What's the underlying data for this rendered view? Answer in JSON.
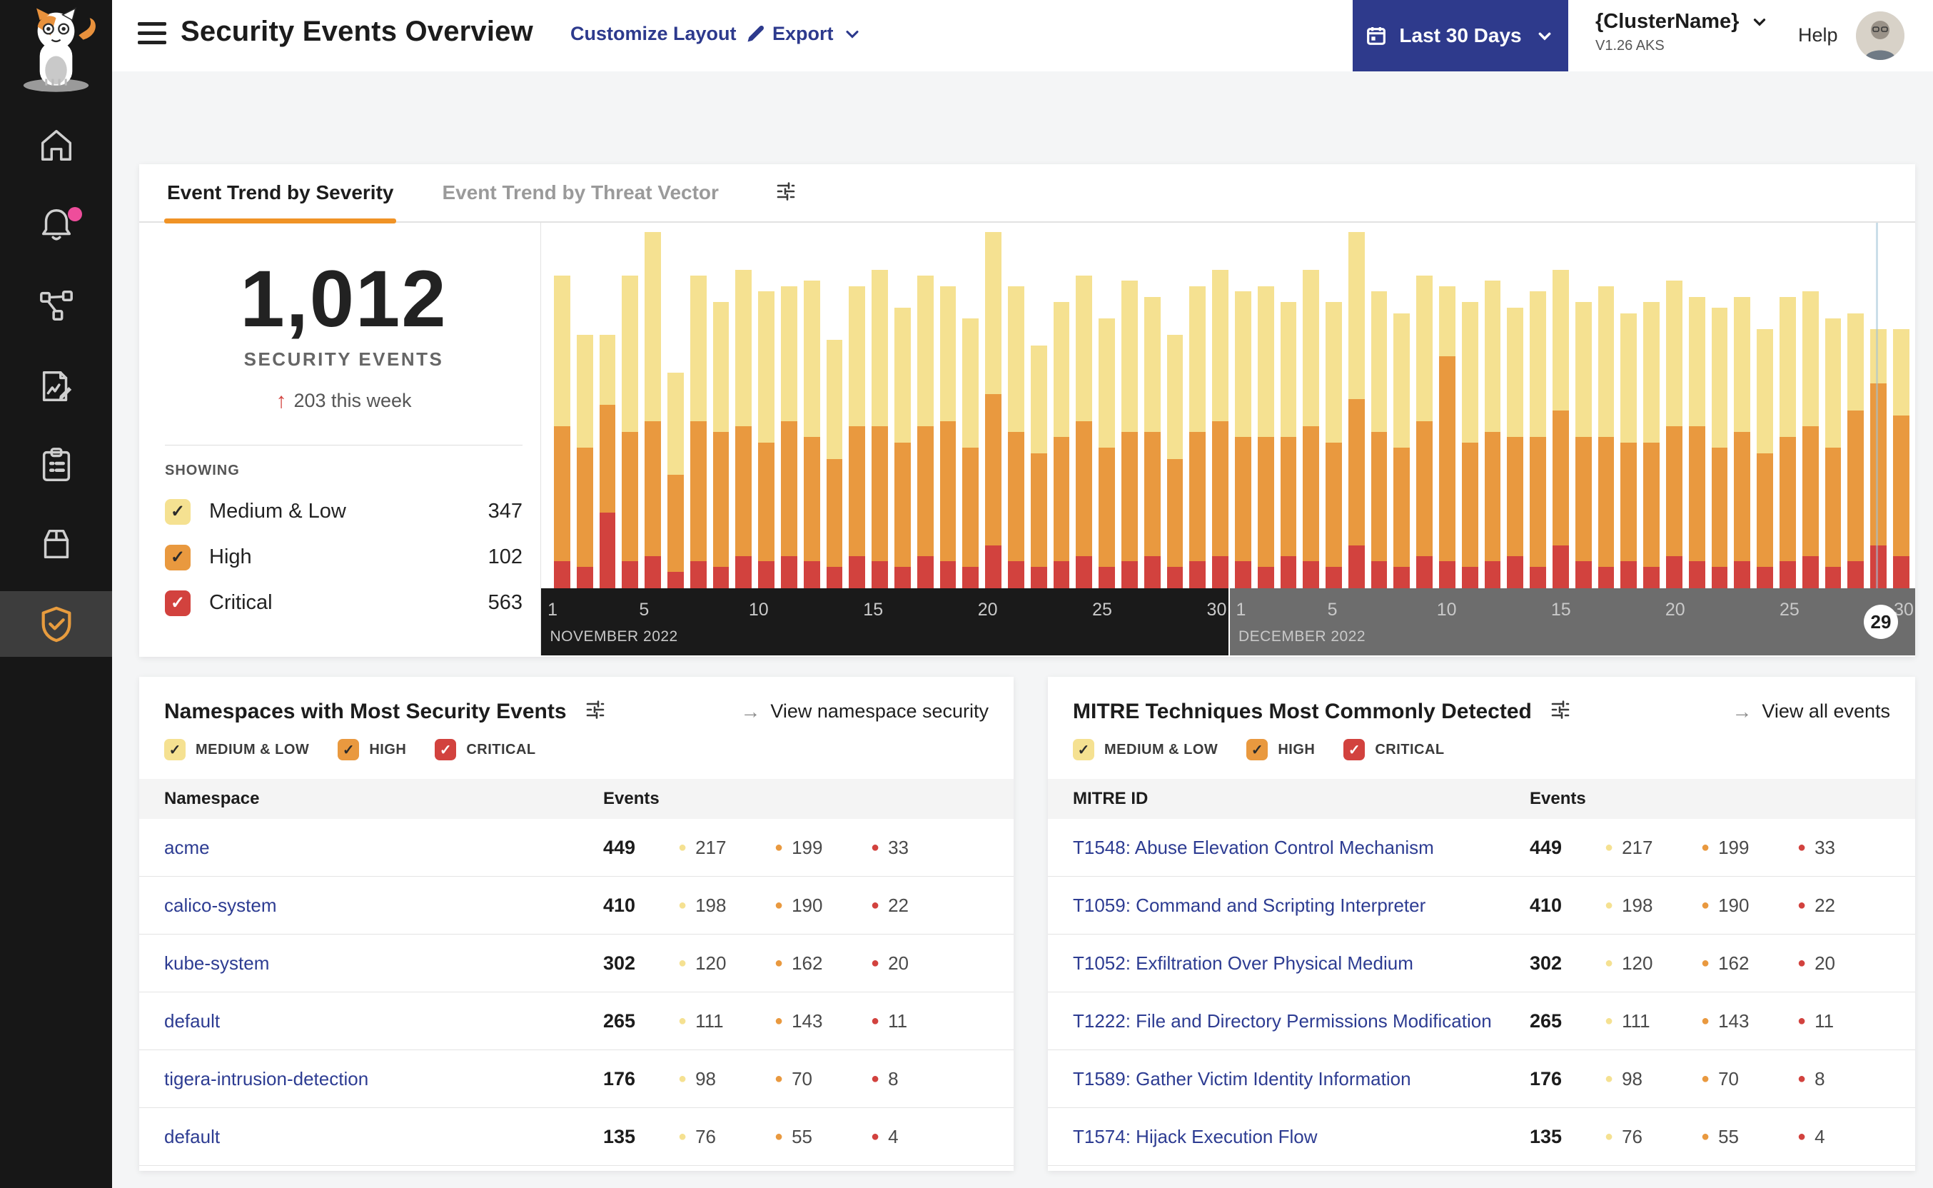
{
  "sidebar": {
    "active_item": "threat-defense",
    "items": [
      {
        "icon": "home-icon",
        "badge": false,
        "active": false
      },
      {
        "icon": "bell-icon",
        "badge": true,
        "active": false
      },
      {
        "icon": "network-graph-icon",
        "badge": false,
        "active": false
      },
      {
        "icon": "report-edit-icon",
        "badge": false,
        "active": false
      },
      {
        "icon": "clipboard-icon",
        "badge": false,
        "active": false
      },
      {
        "icon": "package-icon",
        "badge": false,
        "active": false
      },
      {
        "icon": "shield-check-icon",
        "badge": false,
        "active": true
      }
    ]
  },
  "header": {
    "title": "Security Events Overview",
    "customize_layout_label": "Customize Layout",
    "export_label": "Export",
    "date_range_label": "Last 30 Days",
    "cluster_name": "{ClusterName}",
    "cluster_version": "V1.26 AKS",
    "help_label": "Help"
  },
  "severity_colors": {
    "medium_low": "#f5e191",
    "high": "#e9993f",
    "critical": "#d2423e"
  },
  "trend_card": {
    "tabs": [
      {
        "label": "Event Trend by Severity",
        "active": true
      },
      {
        "label": "Event Trend by Threat Vector",
        "active": false
      }
    ],
    "summary": {
      "total": "1,012",
      "caption": "SECURITY EVENTS",
      "delta_arrow": "↑",
      "delta": "203 this week"
    },
    "showing_label": "SHOWING",
    "legend": [
      {
        "label": "Medium & Low",
        "count": "347",
        "severity": "medium_low"
      },
      {
        "label": "High",
        "count": "102",
        "severity": "high"
      },
      {
        "label": "Critical",
        "count": "563",
        "severity": "critical"
      }
    ]
  },
  "chart_data": {
    "type": "bar",
    "stacked": true,
    "stack_order_bottom_to_top": [
      "critical",
      "high",
      "medium_low"
    ],
    "ylim": [
      0,
      68
    ],
    "legend_position": "left-panel",
    "grid": false,
    "current_day_marker": {
      "month": "DECEMBER 2022",
      "day": 29
    },
    "months": [
      {
        "label": "NOVEMBER 2022",
        "ticks": [
          1,
          5,
          10,
          15,
          20,
          25,
          30
        ],
        "days_critical_high_mediumlow": [
          [
            5,
            25,
            28
          ],
          [
            4,
            22,
            21
          ],
          [
            14,
            20,
            13
          ],
          [
            5,
            24,
            29
          ],
          [
            6,
            25,
            35
          ],
          [
            3,
            18,
            19
          ],
          [
            5,
            26,
            27
          ],
          [
            4,
            25,
            24
          ],
          [
            6,
            24,
            29
          ],
          [
            5,
            22,
            28
          ],
          [
            6,
            25,
            25
          ],
          [
            5,
            23,
            29
          ],
          [
            4,
            20,
            22
          ],
          [
            6,
            24,
            26
          ],
          [
            5,
            25,
            29
          ],
          [
            4,
            23,
            25
          ],
          [
            6,
            24,
            28
          ],
          [
            5,
            26,
            25
          ],
          [
            4,
            22,
            24
          ],
          [
            8,
            28,
            30
          ],
          [
            5,
            24,
            27
          ],
          [
            4,
            21,
            20
          ],
          [
            5,
            23,
            25
          ],
          [
            6,
            25,
            27
          ],
          [
            4,
            22,
            24
          ],
          [
            5,
            24,
            28
          ],
          [
            6,
            23,
            25
          ],
          [
            4,
            20,
            23
          ],
          [
            5,
            24,
            27
          ],
          [
            6,
            25,
            28
          ]
        ]
      },
      {
        "label": "DECEMBER 2022",
        "ticks": [
          1,
          5,
          10,
          15,
          20,
          25,
          30
        ],
        "current_day": 29,
        "days_critical_high_mediumlow": [
          [
            5,
            23,
            27
          ],
          [
            4,
            24,
            28
          ],
          [
            6,
            22,
            25
          ],
          [
            5,
            25,
            29
          ],
          [
            4,
            23,
            26
          ],
          [
            8,
            27,
            31
          ],
          [
            5,
            24,
            26
          ],
          [
            4,
            22,
            25
          ],
          [
            6,
            25,
            27
          ],
          [
            5,
            38,
            13
          ],
          [
            4,
            23,
            26
          ],
          [
            5,
            24,
            28
          ],
          [
            6,
            22,
            24
          ],
          [
            4,
            24,
            27
          ],
          [
            8,
            25,
            26
          ],
          [
            5,
            23,
            25
          ],
          [
            4,
            24,
            28
          ],
          [
            5,
            22,
            24
          ],
          [
            4,
            23,
            26
          ],
          [
            6,
            24,
            27
          ],
          [
            5,
            25,
            24
          ],
          [
            4,
            22,
            26
          ],
          [
            5,
            24,
            25
          ],
          [
            4,
            21,
            23
          ],
          [
            5,
            23,
            26
          ],
          [
            6,
            24,
            25
          ],
          [
            4,
            22,
            24
          ],
          [
            5,
            28,
            18
          ],
          [
            8,
            30,
            10
          ],
          [
            6,
            26,
            16
          ]
        ]
      }
    ]
  },
  "namespaces_card": {
    "title": "Namespaces with Most Security Events",
    "action_label": "View namespace security",
    "filters": [
      {
        "label": "MEDIUM & LOW",
        "severity": "medium_low"
      },
      {
        "label": "HIGH",
        "severity": "high"
      },
      {
        "label": "CRITICAL",
        "severity": "critical"
      }
    ],
    "columns": [
      "Namespace",
      "Events"
    ],
    "rows": [
      {
        "name": "acme",
        "total": "449",
        "medium_low": "217",
        "high": "199",
        "critical": "33"
      },
      {
        "name": "calico-system",
        "total": "410",
        "medium_low": "198",
        "high": "190",
        "critical": "22"
      },
      {
        "name": "kube-system",
        "total": "302",
        "medium_low": "120",
        "high": "162",
        "critical": "20"
      },
      {
        "name": "default",
        "total": "265",
        "medium_low": "111",
        "high": "143",
        "critical": "11"
      },
      {
        "name": "tigera-intrusion-detection",
        "total": "176",
        "medium_low": "98",
        "high": "70",
        "critical": "8"
      },
      {
        "name": "default",
        "total": "135",
        "medium_low": "76",
        "high": "55",
        "critical": "4"
      }
    ]
  },
  "mitre_card": {
    "title": "MITRE Techniques Most Commonly Detected",
    "action_label": "View all events",
    "filters": [
      {
        "label": "MEDIUM & LOW",
        "severity": "medium_low"
      },
      {
        "label": "HIGH",
        "severity": "high"
      },
      {
        "label": "CRITICAL",
        "severity": "critical"
      }
    ],
    "columns": [
      "MITRE ID",
      "Events"
    ],
    "rows": [
      {
        "name": "T1548: Abuse Elevation Control Mechanism",
        "total": "449",
        "medium_low": "217",
        "high": "199",
        "critical": "33"
      },
      {
        "name": "T1059: Command and Scripting Interpreter",
        "total": "410",
        "medium_low": "198",
        "high": "190",
        "critical": "22"
      },
      {
        "name": "T1052: Exfiltration Over Physical Medium",
        "total": "302",
        "medium_low": "120",
        "high": "162",
        "critical": "20"
      },
      {
        "name": "T1222: File and Directory Permissions Modification",
        "total": "265",
        "medium_low": "111",
        "high": "143",
        "critical": "11"
      },
      {
        "name": "T1589: Gather Victim Identity Information",
        "total": "176",
        "medium_low": "98",
        "high": "70",
        "critical": "8"
      },
      {
        "name": "T1574: Hijack Execution Flow",
        "total": "135",
        "medium_low": "76",
        "high": "55",
        "critical": "4"
      }
    ]
  }
}
